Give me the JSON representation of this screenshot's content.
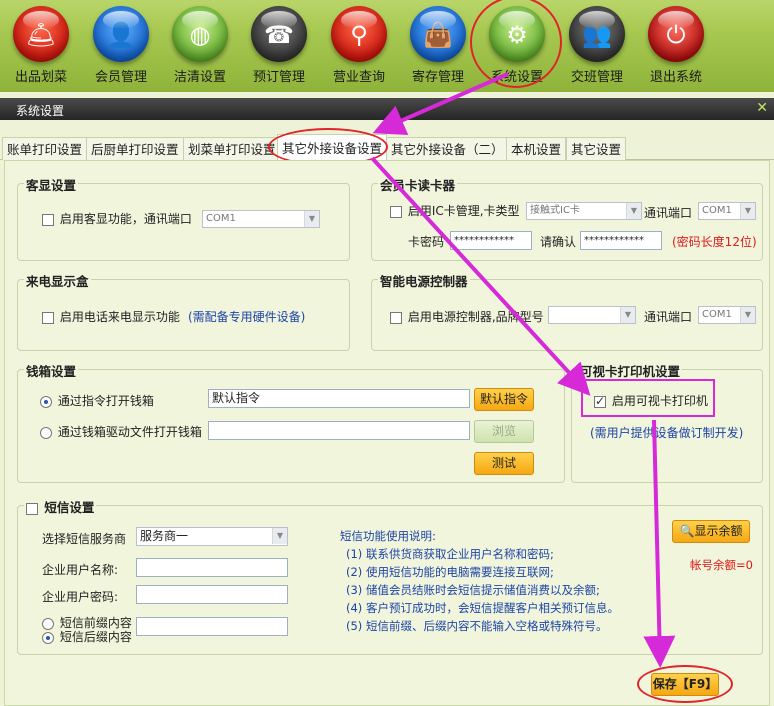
{
  "toolbar": {
    "items": [
      {
        "label": "出品划菜",
        "icon": "cloche-icon"
      },
      {
        "label": "会员管理",
        "icon": "user-icon"
      },
      {
        "label": "洁清设置",
        "icon": "plate-icon"
      },
      {
        "label": "预订管理",
        "icon": "phone-icon"
      },
      {
        "label": "营业查询",
        "icon": "magnifier-icon"
      },
      {
        "label": "寄存管理",
        "icon": "bag-icon"
      },
      {
        "label": "系统设置",
        "icon": "gear-icon"
      },
      {
        "label": "交班管理",
        "icon": "handover-icon"
      },
      {
        "label": "退出系统",
        "icon": "power-icon"
      }
    ]
  },
  "window": {
    "title": "系统设置",
    "close": "✕"
  },
  "tabs": [
    {
      "label": "账单打印设置"
    },
    {
      "label": "后厨单打印设置"
    },
    {
      "label": "划菜单打印设置"
    },
    {
      "label": "其它外接设备设置"
    },
    {
      "label": "其它外接设备（二）"
    },
    {
      "label": "本机设置"
    },
    {
      "label": "其它设置"
    }
  ],
  "customer_display": {
    "title": "客显设置",
    "enable_label": "启用客显功能，通讯端口",
    "port": "COM1"
  },
  "card_reader": {
    "title": "会员卡读卡器",
    "enable_label": "启用IC卡管理,卡类型",
    "card_type": "接触式IC卡",
    "port_label": "通讯端口",
    "port": "COM1",
    "password_label": "卡密码",
    "password_value": "************",
    "confirm_label": "请确认",
    "confirm_value": "************",
    "hint": "(密码长度12位)"
  },
  "caller_id": {
    "title": "来电显示盒",
    "enable_label": "启用电话来电显示功能",
    "note": "(需配备专用硬件设备)"
  },
  "power_ctrl": {
    "title": "智能电源控制器",
    "enable_label": "启用电源控制器,品牌型号",
    "port_label": "通讯端口",
    "port": "COM1"
  },
  "cash_drawer": {
    "title": "钱箱设置",
    "opt1_label": "通过指令打开钱箱",
    "opt1_value": "默认指令",
    "default_btn": "默认指令",
    "opt2_label": "通过钱箱驱动文件打开钱箱",
    "browse_btn": "浏览",
    "test_btn": "测试"
  },
  "visual_card": {
    "title": "可视卡打印机设置",
    "enable_label": "启用可视卡打印机",
    "note": "(需用户提供设备做订制开发)"
  },
  "sms": {
    "title": "短信设置",
    "provider_label": "选择短信服务商",
    "provider_value": "服务商一",
    "user_label": "企业用户名称:",
    "pass_label": "企业用户密码:",
    "prefix_label": "短信前缀内容",
    "suffix_label": "短信后缀内容",
    "help_title": "短信功能使用说明:",
    "help_lines": [
      "(1) 联系供货商获取企业用户名称和密码;",
      "(2) 使用短信功能的电脑需要连接互联网;",
      "(3) 储值会员结账时会短信提示储值消费以及余额;",
      "(4) 客户预订成功时，会短信提醒客户相关预订信息。",
      "(5) 短信前缀、后缀内容不能输入空格或特殊符号。"
    ],
    "balance_btn": "显示余额",
    "balance_text": "帐号余额=0"
  },
  "save_btn": "保存【F9】",
  "colors": {
    "toolbar": "#a7c850",
    "accent": "#f5a812",
    "annotation": "#d62ad8",
    "ring": "#e0242a"
  }
}
